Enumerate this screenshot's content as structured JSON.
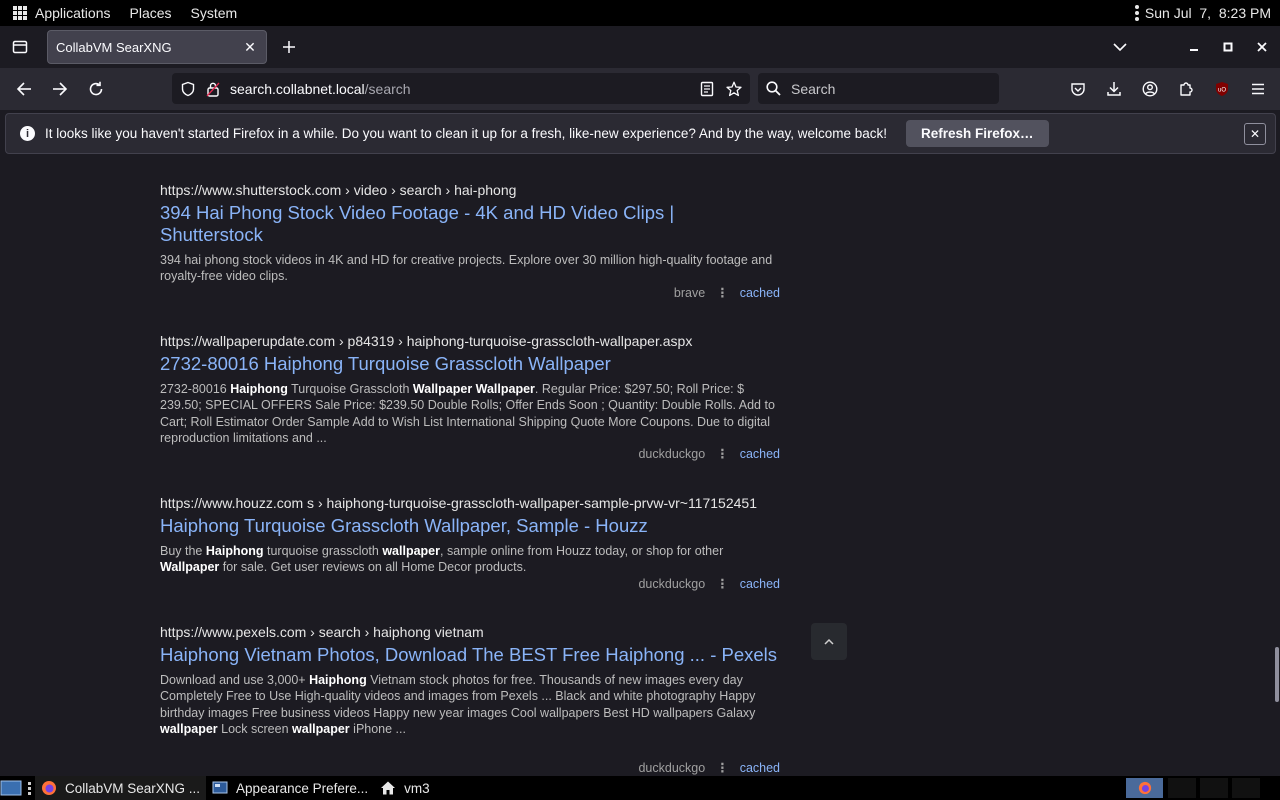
{
  "top_panel": {
    "menus": [
      "Applications",
      "Places",
      "System"
    ],
    "clock": "Sun Jul  7,  8:23 PM"
  },
  "tabs": {
    "active_title": "CollabVM SearXNG"
  },
  "navbar": {
    "url_host": "search.collabnet.local",
    "url_path": "/search",
    "search_placeholder": "Search"
  },
  "notification": {
    "message": "It looks like you haven't started Firefox in a while. Do you want to clean it up for a fresh, like-new experience? And by the way, welcome back!",
    "button": "Refresh Firefox…"
  },
  "results": [
    {
      "site": "https://www.shutterstock.com",
      "path": " › video › search › hai-phong",
      "title": "394 Hai Phong Stock Video Footage - 4K and HD Video Clips | Shutterstock",
      "snippet_html": "394 hai phong stock videos in 4K and HD for creative projects. Explore over 30 million high-quality footage and royalty-free video clips.",
      "engine": "brave",
      "cached": "cached"
    },
    {
      "site": "https://wallpaperupdate.com",
      "path": " › p84319 › haiphong-turquoise-grasscloth-wallpaper.aspx",
      "title": "2732-80016 Haiphong Turquoise Grasscloth Wallpaper",
      "snippet_html": "2732-80016 <b>Haiphong</b> Turquoise Grasscloth <b>Wallpaper Wallpaper</b>. Regular Price: $297.50; Roll Price: $ 239.50; SPECIAL OFFERS Sale Price: $239.50 Double Rolls; Offer Ends Soon ; Quantity: Double Rolls. Add to Cart; Roll Estimator Order Sample Add to Wish List International Shipping Quote More Coupons. Due to digital reproduction limitations and ...",
      "engine": "duckduckgo",
      "cached": "cached"
    },
    {
      "site": "https://www.houzz.com",
      "path": " s › haiphong-turquoise-grasscloth-wallpaper-sample-prvw-vr~117152451",
      "title": "Haiphong Turquoise Grasscloth Wallpaper, Sample - Houzz",
      "snippet_html": "Buy the <b>Haiphong</b> turquoise grasscloth <b>wallpaper</b>, sample online from Houzz today, or shop for other <b>Wallpaper</b> for sale. Get user reviews on all Home Decor products.",
      "engine": "duckduckgo",
      "cached": "cached"
    },
    {
      "site": "https://www.pexels.com",
      "path": " › search › haiphong vietnam",
      "title": "Haiphong Vietnam Photos, Download The BEST Free Haiphong ... - Pexels",
      "snippet_html": "Download and use 3,000+ <b>Haiphong</b> Vietnam stock photos for free. Thousands of new images every day Completely Free to Use High-quality videos and images from Pexels ... Black and white photography Happy birthday images Free business videos Happy new year images Cool wallpapers Best HD wallpapers Galaxy <b>wallpaper</b> Lock screen <b>wallpaper</b> iPhone ...",
      "engine": "duckduckgo",
      "cached": "cached"
    }
  ],
  "taskbar": {
    "tasks": [
      "CollabVM SearXNG ...",
      "Appearance Prefere...",
      "vm3"
    ]
  },
  "colors": {
    "link": "#8ab4f8",
    "page_bg": "#1c1b22",
    "toolbar_bg": "#2b2a33"
  }
}
